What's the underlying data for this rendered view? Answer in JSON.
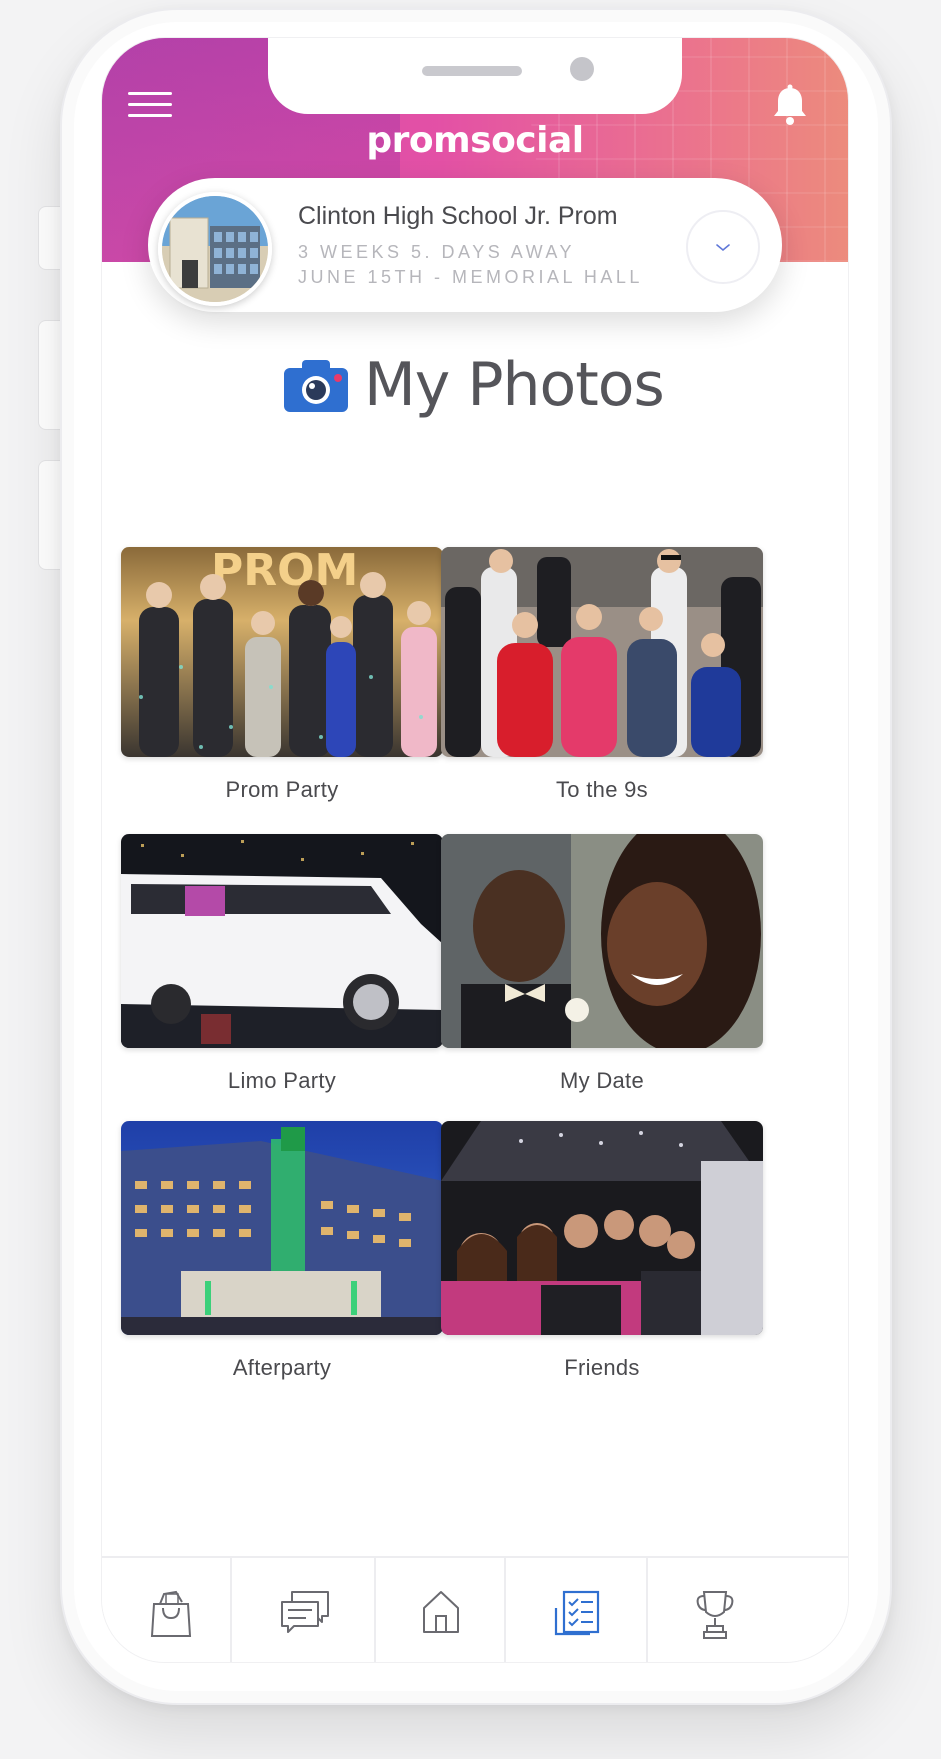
{
  "app": {
    "brand": "promsocial"
  },
  "icons": {
    "menu": "hamburger-menu-icon",
    "notifications": "bell-icon",
    "dropdown": "chevron-down-icon",
    "section": "camera-icon",
    "nav": [
      "shopping-bag-icon",
      "chat-bubbles-icon",
      "home-icon",
      "checklist-icon",
      "trophy-icon"
    ]
  },
  "colors": {
    "banner_start": "#c93fa3",
    "banner_end": "#e76e5c",
    "accent_blue": "#2f6fd0",
    "nav_active": "#2f6fd0",
    "text": "#4a4a4e"
  },
  "event": {
    "title": "Clinton High School Jr. Prom",
    "countdown": "3 WEEKS  5. DAYS AWAY",
    "date_location": "JUNE 15TH -  MEMORIAL  HALL"
  },
  "section": {
    "title": "My Photos"
  },
  "albums": [
    {
      "label": "Prom Party"
    },
    {
      "label": "To the 9s"
    },
    {
      "label": "Limo Party"
    },
    {
      "label": "My Date"
    },
    {
      "label": "Afterparty"
    },
    {
      "label": "Friends"
    }
  ],
  "nav": {
    "active_index": 3
  }
}
